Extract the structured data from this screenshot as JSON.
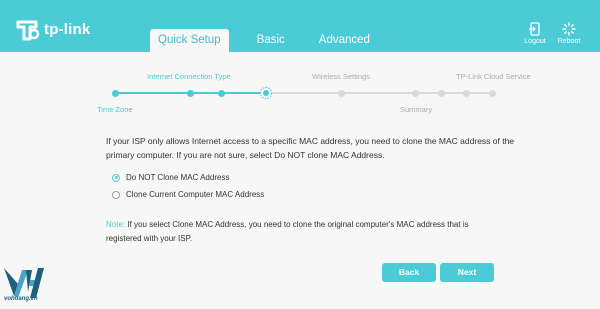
{
  "brand": {
    "name": "tp-link",
    "accent": "#4acbd6"
  },
  "tabs": [
    {
      "label": "Quick Setup",
      "active": true
    },
    {
      "label": "Basic",
      "active": false
    },
    {
      "label": "Advanced",
      "active": false
    }
  ],
  "header_actions": {
    "logout_label": "Logout",
    "reboot_label": "Reboot"
  },
  "stepper": {
    "top_labels": {
      "internet": "Internet Connection Type",
      "wireless": "Wireless Settings",
      "cloud": "TP-Link Cloud Service"
    },
    "bottom_labels": {
      "timezone": "Time Zone",
      "summary": "Summary"
    }
  },
  "content": {
    "intro": "If your ISP only allows Internet access to a specific MAC address, you need to clone the MAC address of the primary computer. If you are not sure, select Do NOT clone MAC Address.",
    "options": [
      {
        "label": "Do NOT Clone MAC Address",
        "selected": true
      },
      {
        "label": "Clone Current Computer MAC Address",
        "selected": false
      }
    ],
    "note_label": "Note:",
    "note_text": " If you select Clone MAC Address, you need to clone the original computer's MAC address that is registered with your ISP."
  },
  "buttons": {
    "back": "Back",
    "next": "Next"
  },
  "watermark": {
    "text": "vohoang.vn"
  }
}
